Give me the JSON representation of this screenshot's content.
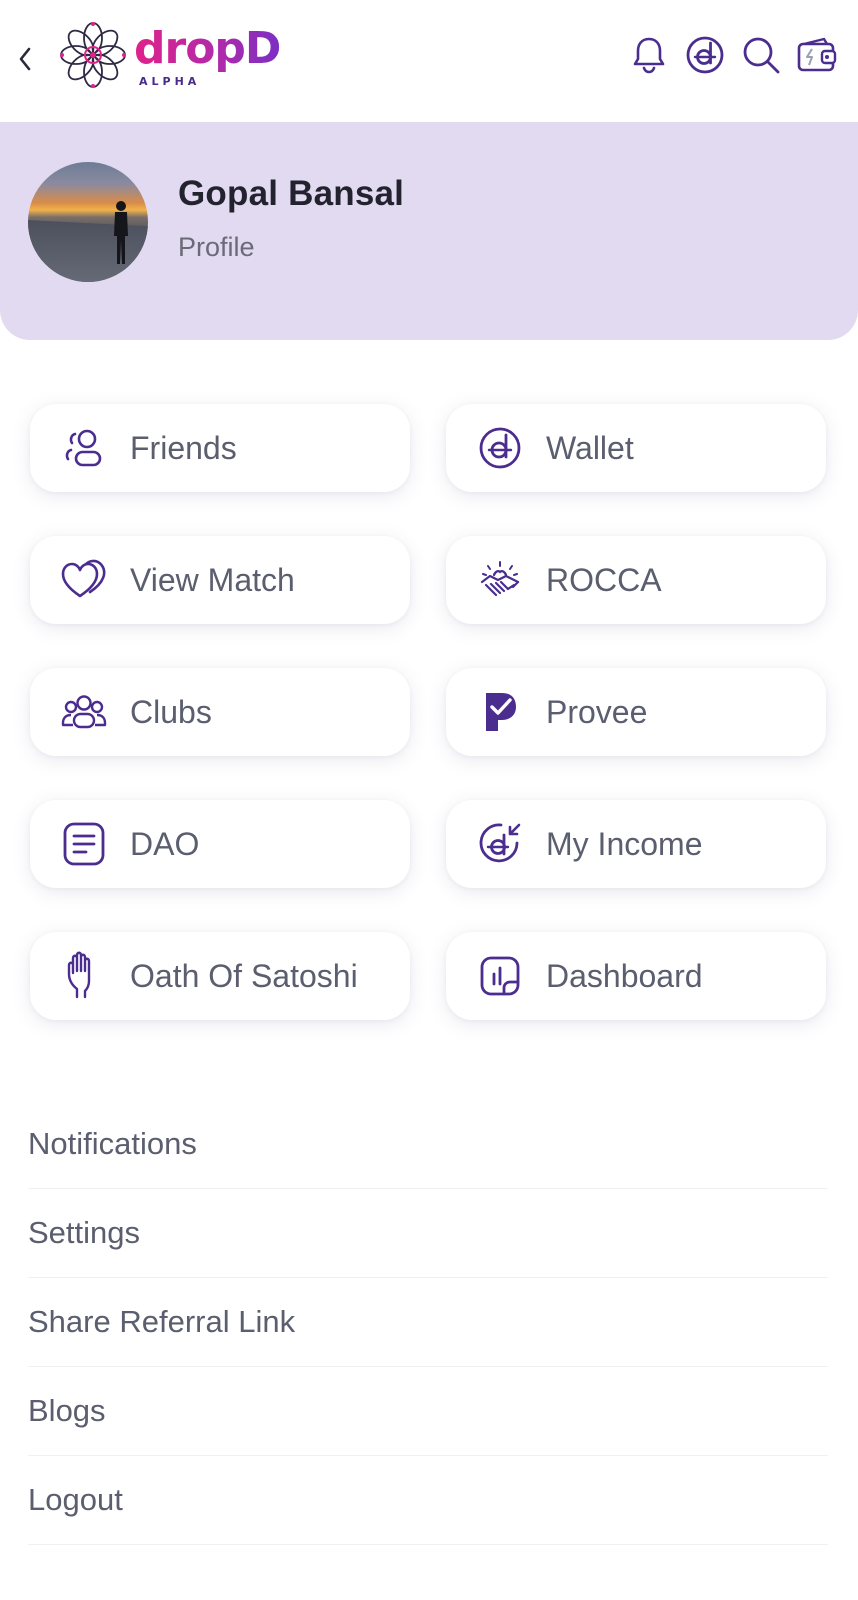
{
  "header": {
    "logo_text": "dropD",
    "logo_subtext": "ALPHA",
    "icons": [
      "back-chevron-icon",
      "bell-icon",
      "dropd-coin-icon",
      "search-icon",
      "wallet-icon"
    ]
  },
  "profile": {
    "name": "Gopal Bansal",
    "subtitle": "Profile"
  },
  "tiles": [
    {
      "label": "Friends",
      "icon": "friends-icon"
    },
    {
      "label": "Wallet",
      "icon": "wallet-coin-icon"
    },
    {
      "label": "View Match",
      "icon": "hearts-icon"
    },
    {
      "label": "ROCCA",
      "icon": "handshake-icon"
    },
    {
      "label": "Clubs",
      "icon": "group-icon"
    },
    {
      "label": "Provee",
      "icon": "provee-check-icon"
    },
    {
      "label": "DAO",
      "icon": "document-icon"
    },
    {
      "label": "My Income",
      "icon": "income-coin-icon"
    },
    {
      "label": "Oath Of Satoshi",
      "icon": "raised-hand-icon"
    },
    {
      "label": "Dashboard",
      "icon": "dashboard-chart-icon"
    }
  ],
  "menu": [
    {
      "label": "Notifications"
    },
    {
      "label": "Settings"
    },
    {
      "label": "Share Referral Link"
    },
    {
      "label": "Blogs"
    },
    {
      "label": "Logout"
    }
  ],
  "colors": {
    "accent": "#4b2d8f",
    "brand_pink": "#e0228a",
    "banner_bg": "#e2daf0",
    "text": "#5a5e6e"
  }
}
